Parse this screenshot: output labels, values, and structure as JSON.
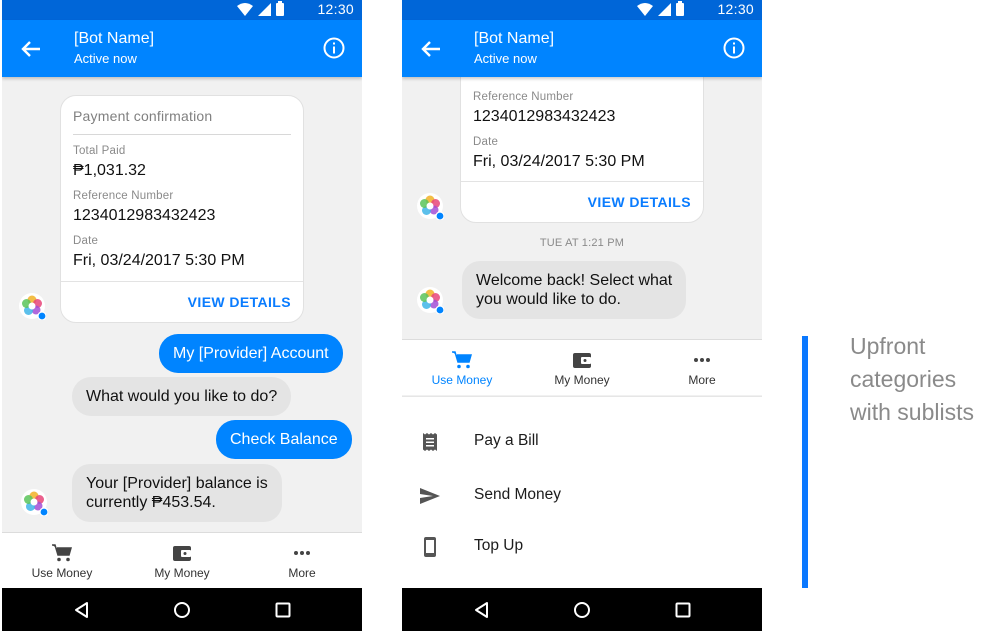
{
  "colors": {
    "brand": "#0084ff",
    "status_bar": "#0066d8",
    "bot_bubble": "#e4e4e4",
    "annotation": "#0a78ff"
  },
  "status_bar": {
    "time": "12:30"
  },
  "header": {
    "bot_name": "[Bot Name]",
    "status": "Active now",
    "back_icon": "arrow-left-icon",
    "info_icon": "info-icon"
  },
  "screen1": {
    "receipt": {
      "title": "Payment confirmation",
      "fields": [
        {
          "label": "Total Paid",
          "value": "₱1,031.32"
        },
        {
          "label": "Reference Number",
          "value": "1234012983432423"
        },
        {
          "label": "Date",
          "value": "Fri, 03/24/2017 5:30 PM"
        }
      ],
      "action": "VIEW DETAILS"
    },
    "messages": [
      {
        "from": "user",
        "text": "My [Provider] Account"
      },
      {
        "from": "bot",
        "text": "What would you like to do?"
      },
      {
        "from": "user",
        "text": "Check Balance"
      },
      {
        "from": "bot",
        "text": "Your [Provider] balance is\ncurrently ₱453.54."
      }
    ]
  },
  "screen2": {
    "receipt": {
      "fields": [
        {
          "label": "Reference Number",
          "value": "1234012983432423"
        },
        {
          "label": "Date",
          "value": "Fri, 03/24/2017 5:30 PM"
        }
      ],
      "action": "VIEW DETAILS"
    },
    "timestamp": "TUE AT 1:21 PM",
    "messages": [
      {
        "from": "bot",
        "text": "Welcome back! Select what\nyou would like to do."
      }
    ],
    "submenu": [
      {
        "label": "Pay a Bill",
        "icon": "receipt-icon"
      },
      {
        "label": "Send Money",
        "icon": "send-icon"
      },
      {
        "label": "Top Up",
        "icon": "phone-icon"
      }
    ]
  },
  "tabs": [
    {
      "label": "Use Money",
      "icon": "cart-icon"
    },
    {
      "label": "My Money",
      "icon": "wallet-icon"
    },
    {
      "label": "More",
      "icon": "more-dots-icon"
    }
  ],
  "nav": {
    "back": "nav-back-icon",
    "home": "nav-home-icon",
    "recents": "nav-recents-icon"
  },
  "annotation": {
    "text": "Upfront\ncategories\nwith sublists"
  }
}
